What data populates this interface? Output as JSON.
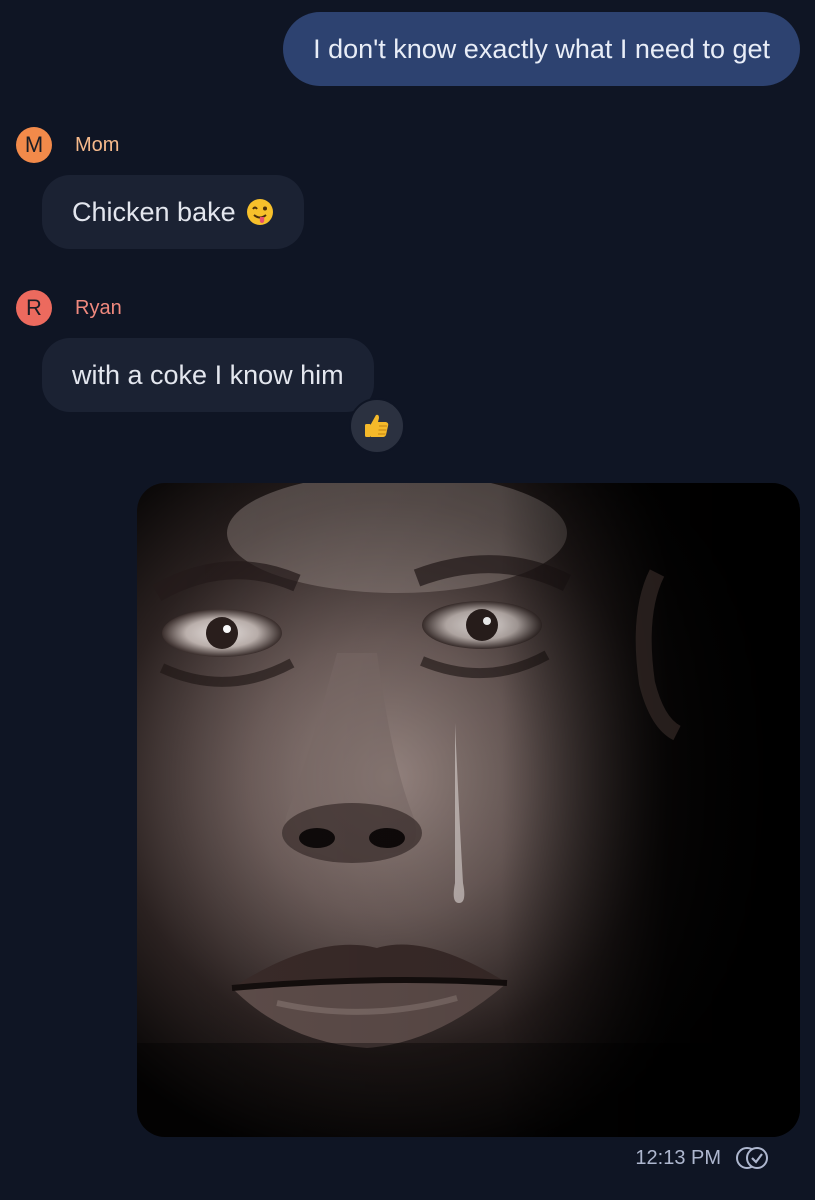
{
  "colors": {
    "background": "#0f1524",
    "outgoing_bubble": "#2d4270",
    "incoming_bubble": "#1b2233",
    "mom_avatar": "#f28a4a",
    "mom_name": "#f5b98b",
    "ryan_avatar": "#ec6a5e",
    "ryan_name": "#f0897e"
  },
  "messages": {
    "outgoing_text": "I don't know exactly what I need to get",
    "mom": {
      "avatar_letter": "M",
      "name": "Mom",
      "text": "Chicken bake",
      "emoji": "winking-face-with-tongue-icon"
    },
    "ryan": {
      "avatar_letter": "R",
      "name": "Ryan",
      "text": "with a coke I know him",
      "reaction": "thumbs-up-icon"
    }
  },
  "photo": {
    "description_icon": "crying-face-photo"
  },
  "footer": {
    "time": "12:13 PM",
    "status_icon": "read-receipt-icon"
  }
}
